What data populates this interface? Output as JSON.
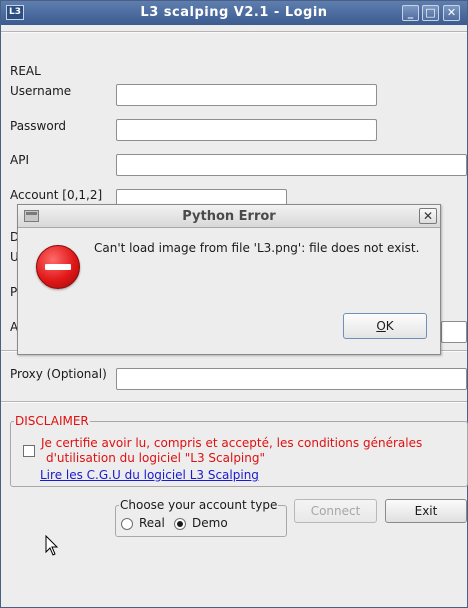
{
  "window": {
    "app_icon": "L3",
    "title": "L3 scalping V2.1 - Login",
    "minimize": "_",
    "maximize": "□",
    "close": "✕"
  },
  "form": {
    "section_real": "REAL",
    "username_label": "Username",
    "username_value": "",
    "password_label": "Password",
    "password_value": "",
    "api_label": "API",
    "api_value": "",
    "account_label": "Account [0,1,2]",
    "account_value": "",
    "hidden_label_d": "D",
    "hidden_label_u": "U",
    "hidden_label_p": "P",
    "hidden_label_a": "A",
    "proxy_label": "Proxy (Optional)",
    "proxy_value": ""
  },
  "disclaimer": {
    "title": "DISCLAIMER",
    "checked": false,
    "text_line1": "Je certifie avoir lu, compris et accepté, les conditions générales",
    "text_line2": "d'utilisation du logiciel \"L3 Scalping\"",
    "link": "Lire les C.G.U du logiciel L3 Scalping"
  },
  "account_type": {
    "title": "Choose your account type",
    "options": [
      "Real",
      "Demo"
    ],
    "selected": "Demo"
  },
  "buttons": {
    "connect": "Connect",
    "exit": "Exit"
  },
  "dialog": {
    "title": "Python Error",
    "close": "✕",
    "message": "Can't load image from file 'L3.png': file does not exist.",
    "ok_underlined": "O",
    "ok_rest": "K",
    "icon": "error-icon"
  },
  "colors": {
    "titlebar": "#4a6aa0",
    "disclaimer_red": "#e01010",
    "link_blue": "#1a1ad0"
  }
}
